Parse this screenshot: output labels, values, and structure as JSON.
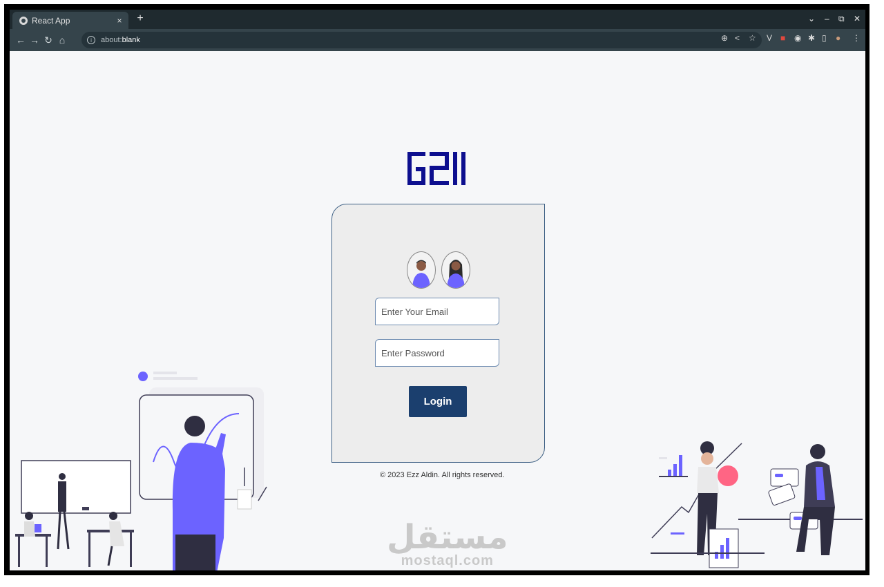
{
  "browser": {
    "tab_title": "React App",
    "tab_close": "×",
    "new_tab": "+",
    "url_prefix": "about:",
    "url_main": "blank",
    "window_controls": [
      "⌄",
      "–",
      "⧉",
      "✕"
    ]
  },
  "login": {
    "email_placeholder": "Enter Your Email",
    "password_placeholder": "Enter Password",
    "button_label": "Login"
  },
  "footer": {
    "copyright": "© 2023 Ezz Aldin. All rights reserved."
  },
  "watermark": {
    "arabic": "مستقل",
    "latin": "mostaql.com"
  },
  "colors": {
    "brand": "#0d0f8f",
    "accent": "#6c63ff",
    "button": "#1b3f6e",
    "border": "#3b5e83"
  }
}
